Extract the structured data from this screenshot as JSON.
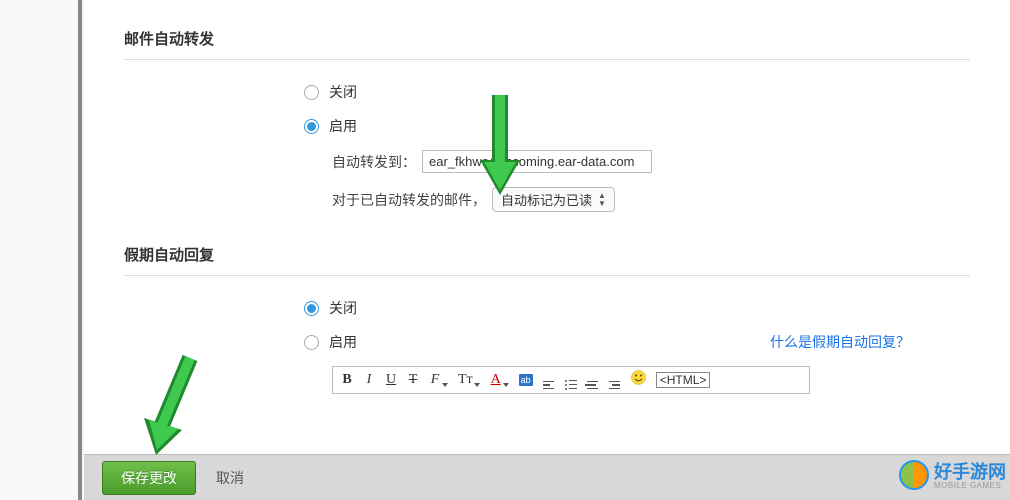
{
  "autoforward": {
    "title": "邮件自动转发",
    "off_label": "关闭",
    "on_label": "启用",
    "selected": "on",
    "forward_to_label": "自动转发到：",
    "forward_to_value": "ear_fkhwe@incoming.ear-data.com",
    "forwarded_label": "对于已自动转发的邮件，",
    "forwarded_action": "自动标记为已读"
  },
  "vacation": {
    "title": "假期自动回复",
    "off_label": "关闭",
    "on_label": "启用",
    "selected": "off",
    "help_link": "什么是假期自动回复？"
  },
  "toolbar": {
    "bold": "B",
    "italic": "I",
    "underline": "U",
    "strike": "T",
    "fontface": "F",
    "fontsize": "Tт",
    "fontcolor": "A",
    "highlight": "ab",
    "smile": "☺",
    "html": "<HTML>"
  },
  "footer": {
    "save": "保存更改",
    "cancel": "取消"
  },
  "logo": {
    "name": "好手游网",
    "sub": "MOBILE GAMES"
  }
}
